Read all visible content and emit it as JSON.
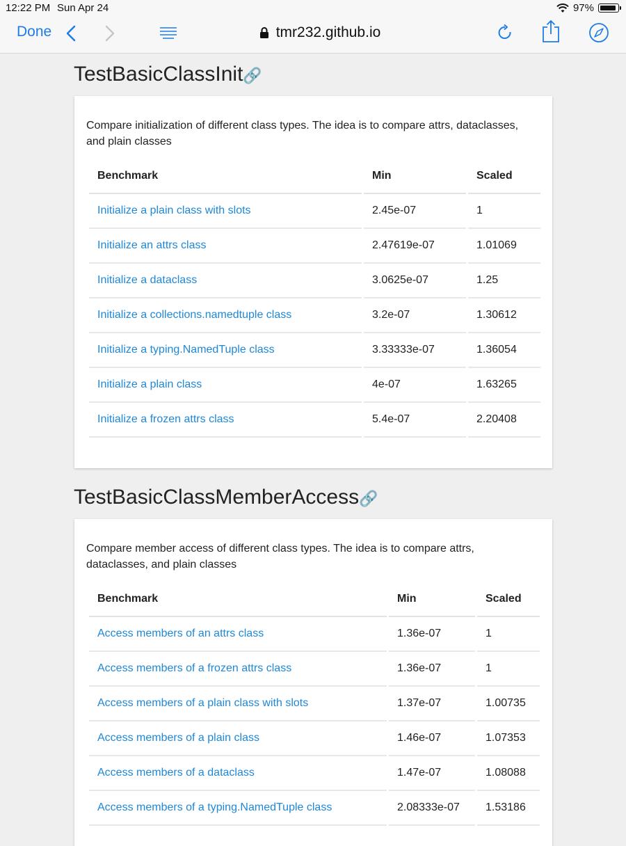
{
  "status_bar": {
    "time": "12:22 PM",
    "date": "Sun Apr 24",
    "battery": "97%"
  },
  "toolbar": {
    "done_label": "Done",
    "url": "tmr232.github.io"
  },
  "sections": [
    {
      "title": "TestBasicClassInit",
      "description": "Compare initialization of different class types. The idea is to compare attrs, dataclasses, and plain classes",
      "headers": [
        "Benchmark",
        "Min",
        "Scaled"
      ],
      "rows": [
        {
          "name": "Initialize a plain class with slots",
          "min": "2.45e-07",
          "scaled": "1"
        },
        {
          "name": "Initialize an attrs class",
          "min": "2.47619e-07",
          "scaled": "1.01069"
        },
        {
          "name": "Initialize a dataclass",
          "min": "3.0625e-07",
          "scaled": "1.25"
        },
        {
          "name": "Initialize a collections.namedtuple class",
          "min": "3.2e-07",
          "scaled": "1.30612"
        },
        {
          "name": "Initialize a typing.NamedTuple class",
          "min": "3.33333e-07",
          "scaled": "1.36054"
        },
        {
          "name": "Initialize a plain class",
          "min": "4e-07",
          "scaled": "1.63265"
        },
        {
          "name": "Initialize a frozen attrs class",
          "min": "5.4e-07",
          "scaled": "2.20408"
        }
      ]
    },
    {
      "title": "TestBasicClassMemberAccess",
      "description": "Compare member access of different class types. The idea is to compare attrs, dataclasses, and plain classes",
      "headers": [
        "Benchmark",
        "Min",
        "Scaled"
      ],
      "rows": [
        {
          "name": "Access members of an attrs class",
          "min": "1.36e-07",
          "scaled": "1"
        },
        {
          "name": "Access members of a frozen attrs class",
          "min": "1.36e-07",
          "scaled": "1"
        },
        {
          "name": "Access members of a plain class with slots",
          "min": "1.37e-07",
          "scaled": "1.00735"
        },
        {
          "name": "Access members of a plain class",
          "min": "1.46e-07",
          "scaled": "1.07353"
        },
        {
          "name": "Access members of a dataclass",
          "min": "1.47e-07",
          "scaled": "1.08088"
        },
        {
          "name": "Access members of a typing.NamedTuple class",
          "min": "2.08333e-07",
          "scaled": "1.53186"
        }
      ]
    }
  ],
  "icons": {
    "anchor": "link-icon",
    "accent": "#1f7be6",
    "link_color": "#1e88d8"
  }
}
